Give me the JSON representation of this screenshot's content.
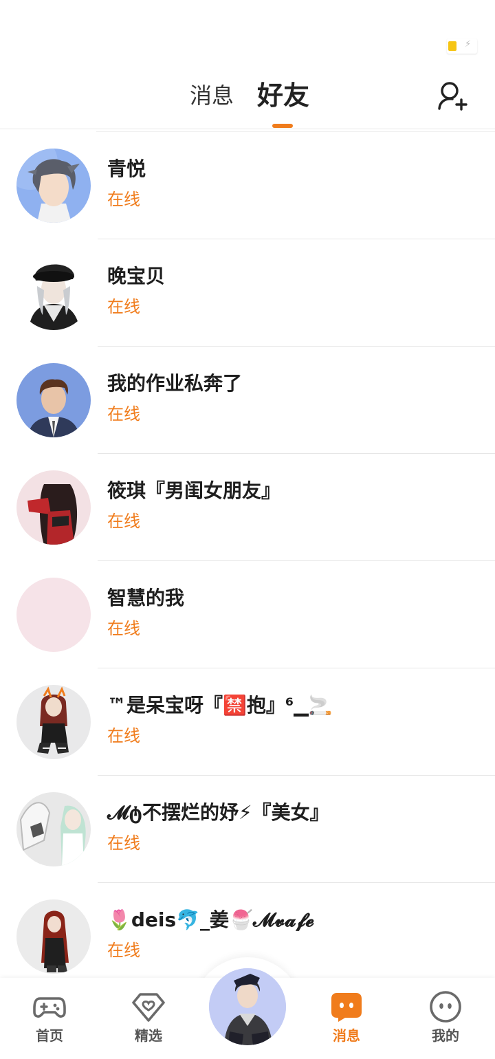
{
  "header": {
    "tab_messages": "消息",
    "tab_friends": "好友",
    "active_tab": "好友",
    "add_friend_icon": "add-user-icon"
  },
  "colors": {
    "accent": "#f07c1c",
    "text_primary": "#1e1e1e",
    "divider": "#e6e6e6"
  },
  "friends": [
    {
      "name": "青悦",
      "status": "在线"
    },
    {
      "name": "晚宝贝",
      "status": "在线"
    },
    {
      "name": "我的作业私奔了",
      "status": "在线"
    },
    {
      "name": "筱琪『男闺女朋友』",
      "status": "在线"
    },
    {
      "name": "智慧的我",
      "status": "在线"
    },
    {
      "name": "™是呆宝呀『🈲抱』⁶▁🚬",
      "status": "在线"
    },
    {
      "name": "𝓜ტ不摆烂的妤⚡『美女』",
      "status": "在线"
    },
    {
      "name": "🌷deis🐬_姜🍧𝓜𝓿𝓪𝓯𝓮",
      "status": "在线"
    }
  ],
  "bottom_nav": {
    "home_label": "首页",
    "featured_label": "精选",
    "messages_label": "消息",
    "me_label": "我的",
    "active": "消息"
  }
}
